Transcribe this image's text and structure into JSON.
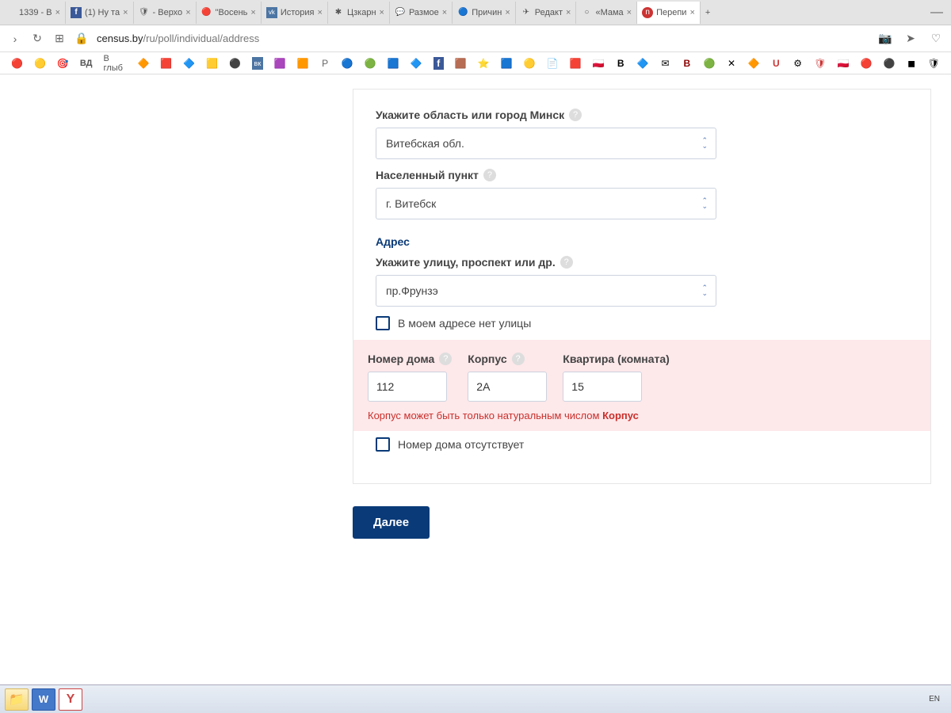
{
  "browser": {
    "tabs": [
      {
        "icon": "",
        "label": "1339 - B"
      },
      {
        "icon": "f",
        "label": "(1) Ну та"
      },
      {
        "icon": "🛡",
        "label": "- Верхо"
      },
      {
        "icon": "🔴",
        "label": "\"Восень"
      },
      {
        "icon": "vk",
        "label": "История"
      },
      {
        "icon": "✱",
        "label": "Цзкарн"
      },
      {
        "icon": "💬",
        "label": "Размое"
      },
      {
        "icon": "🔵",
        "label": "Причин"
      },
      {
        "icon": "✈",
        "label": "Редакт"
      },
      {
        "icon": "○",
        "label": "«Мама"
      },
      {
        "icon": "⓪",
        "label": "Перепи"
      }
    ],
    "active_tab_index": 10,
    "url_domain": "census.by",
    "url_path": "/ru/poll/individual/address",
    "bookmark_text": "В глыб"
  },
  "form": {
    "region_label": "Укажите область или город Минск",
    "region_value": "Витебская обл.",
    "city_label": "Населенный пункт",
    "city_value": "г. Витебск",
    "address_section": "Адрес",
    "street_label": "Укажите улицу, проспект или др.",
    "street_value": "пр.Фрунзэ",
    "no_street_chk": "В моем адресе нет улицы",
    "house_label": "Номер дома",
    "korpus_label": "Корпус",
    "apt_label": "Квартира (комната)",
    "house_value": "112",
    "korpus_value": "2А",
    "apt_value": "15",
    "error_text": "Корпус может быть только натуральным числом ",
    "error_field": "Корпус",
    "no_house_chk": "Номер дома отсутствует",
    "next_btn": "Далее"
  },
  "taskbar": {
    "lang": "EN"
  }
}
